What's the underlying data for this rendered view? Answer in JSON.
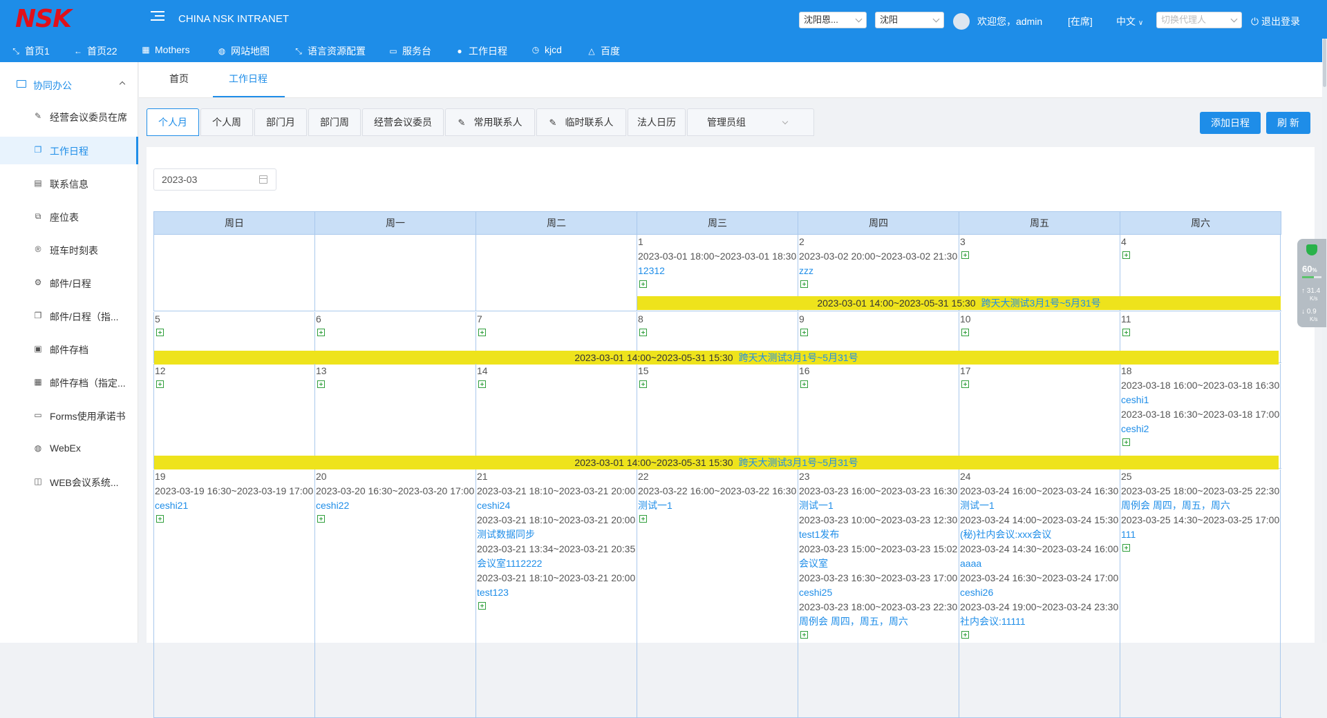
{
  "app": {
    "logo": "NSK",
    "title": "CHINA NSK INTRANET",
    "org_select": "沈阳恩...",
    "city_select": "沈阳",
    "welcome": "欢迎您，admin",
    "status": "[在席]",
    "language": "中文",
    "proxy_placeholder": "切换代理人",
    "logout": "退出登录"
  },
  "nav": [
    {
      "icon": "shrink-icon",
      "label": "首页1"
    },
    {
      "icon": "back-arrow-icon",
      "label": "首页22"
    },
    {
      "icon": "grid-icon",
      "label": "Mothers"
    },
    {
      "icon": "globe-icon",
      "label": "网站地图"
    },
    {
      "icon": "shrink-icon",
      "label": "语言资源配置"
    },
    {
      "icon": "monitor-icon",
      "label": "服务台"
    },
    {
      "icon": "calendar-badge-icon",
      "label": "工作日程"
    },
    {
      "icon": "clock-icon",
      "label": "kjcd"
    },
    {
      "icon": "warning-icon",
      "label": "百度"
    }
  ],
  "sidebar": {
    "group": "协同办公",
    "items": [
      {
        "icon": "edit-icon",
        "label": "经营会议委员在席"
      },
      {
        "icon": "copy-icon",
        "label": "工作日程"
      },
      {
        "icon": "contact-file-icon",
        "label": "联系信息"
      },
      {
        "icon": "seat-icon",
        "label": "座位表"
      },
      {
        "icon": "registered-icon",
        "label": "班车时刻表"
      },
      {
        "icon": "gear-icon",
        "label": "邮件/日程"
      },
      {
        "icon": "copy-icon",
        "label": "邮件/日程（指..."
      },
      {
        "icon": "image-icon",
        "label": "邮件存档"
      },
      {
        "icon": "grid-icon",
        "label": "邮件存档（指定..."
      },
      {
        "icon": "form-icon",
        "label": "Forms使用承诺书"
      },
      {
        "icon": "globe-icon",
        "label": "WebEx"
      },
      {
        "icon": "window-icon",
        "label": "WEB会议系统..."
      }
    ]
  },
  "tabs": [
    "首页",
    "工作日程"
  ],
  "subtabs": [
    "个人月",
    "个人周",
    "部门月",
    "部门周",
    "经营会议委员",
    "常用联系人",
    "临时联系人",
    "法人日历",
    "管理员组"
  ],
  "buttons": {
    "add": "添加日程",
    "refresh": "刷 新"
  },
  "month_value": "2023-03",
  "weekdays": [
    "周日",
    "周一",
    "周二",
    "周三",
    "周四",
    "周五",
    "周六"
  ],
  "span_event": {
    "time": "2023-03-01 14:00~2023-05-31 15:30",
    "title": "跨天大测试3月1号~5月31号"
  },
  "weeks": [
    {
      "days": [
        {
          "d": "",
          "events": []
        },
        {
          "d": "",
          "events": []
        },
        {
          "d": "",
          "events": []
        },
        {
          "d": "1",
          "add": true,
          "events": [
            {
              "time": "2023-03-01 18:00~2023-03-01 18:30",
              "title": "12312"
            }
          ]
        },
        {
          "d": "2",
          "add": true,
          "events": [
            {
              "time": "2023-03-02 20:00~2023-03-02 21:30",
              "title": "zzz"
            }
          ]
        },
        {
          "d": "3",
          "add": true,
          "events": []
        },
        {
          "d": "4",
          "add": true,
          "events": []
        }
      ]
    },
    {
      "days": [
        {
          "d": "5",
          "add": true,
          "events": []
        },
        {
          "d": "6",
          "add": true,
          "events": []
        },
        {
          "d": "7",
          "add": true,
          "events": []
        },
        {
          "d": "8",
          "add": true,
          "events": []
        },
        {
          "d": "9",
          "add": true,
          "events": []
        },
        {
          "d": "10",
          "add": true,
          "events": []
        },
        {
          "d": "11",
          "add": true,
          "events": []
        }
      ]
    },
    {
      "days": [
        {
          "d": "12",
          "add": true,
          "events": []
        },
        {
          "d": "13",
          "add": true,
          "events": []
        },
        {
          "d": "14",
          "add": true,
          "events": []
        },
        {
          "d": "15",
          "add": true,
          "events": []
        },
        {
          "d": "16",
          "add": true,
          "events": []
        },
        {
          "d": "17",
          "add": true,
          "events": []
        },
        {
          "d": "18",
          "add": true,
          "events": [
            {
              "time": "2023-03-18 16:00~2023-03-18 16:30",
              "title": "ceshi1"
            },
            {
              "time": "2023-03-18 16:30~2023-03-18 17:00",
              "title": "ceshi2"
            }
          ]
        }
      ]
    },
    {
      "days": [
        {
          "d": "19",
          "add": true,
          "events": [
            {
              "time": "2023-03-19 16:30~2023-03-19 17:00",
              "title": "ceshi21"
            }
          ]
        },
        {
          "d": "20",
          "add": true,
          "events": [
            {
              "time": "2023-03-20 16:30~2023-03-20 17:00",
              "title": "ceshi22"
            }
          ]
        },
        {
          "d": "21",
          "add": true,
          "events": [
            {
              "time": "2023-03-21 18:10~2023-03-21 20:00",
              "title": "ceshi24"
            },
            {
              "time": "2023-03-21 18:10~2023-03-21 20:00",
              "title": "测试数据同步"
            },
            {
              "time": "2023-03-21 13:34~2023-03-21 20:35",
              "title": "会议室1112222"
            },
            {
              "time": "2023-03-21 18:10~2023-03-21 20:00",
              "title": "test123"
            }
          ]
        },
        {
          "d": "22",
          "add": true,
          "events": [
            {
              "time": "2023-03-22 16:00~2023-03-22 16:30",
              "title": "测试一1"
            }
          ]
        },
        {
          "d": "23",
          "add": true,
          "events": [
            {
              "time": "2023-03-23 16:00~2023-03-23 16:30",
              "title": "测试一1"
            },
            {
              "time": "2023-03-23 10:00~2023-03-23 12:30",
              "title": "test1发布"
            },
            {
              "time": "2023-03-23 15:00~2023-03-23 15:02",
              "title": "会议室"
            },
            {
              "time": "2023-03-23 16:30~2023-03-23 17:00",
              "title": "ceshi25"
            },
            {
              "time": "2023-03-23 18:00~2023-03-23 22:30",
              "title": "周例会 周四，周五，周六"
            }
          ]
        },
        {
          "d": "24",
          "add": true,
          "events": [
            {
              "time": "2023-03-24 16:00~2023-03-24 16:30",
              "title": "测试一1"
            },
            {
              "time": "2023-03-24 14:00~2023-03-24 15:30",
              "title": "(秘)社内会议:xxx会议"
            },
            {
              "time": "2023-03-24 14:30~2023-03-24 16:00",
              "title": "aaaa"
            },
            {
              "time": "2023-03-24 16:30~2023-03-24 17:00",
              "title": "ceshi26"
            },
            {
              "time": "2023-03-24 19:00~2023-03-24 23:30",
              "title": "社内会议:11111"
            }
          ]
        },
        {
          "d": "25",
          "add": true,
          "events": [
            {
              "time": "2023-03-25 18:00~2023-03-25 22:30",
              "title": "周例会 周四，周五，周六"
            },
            {
              "time": "2023-03-25 14:30~2023-03-25 17:00",
              "title": "111"
            }
          ]
        }
      ]
    }
  ],
  "net_monitor": {
    "percent": "60",
    "percent_unit": "%",
    "up": "31.4",
    "down": "0.9",
    "unit": "K/s"
  },
  "colors": {
    "brand_blue": "#1e8de8",
    "logo_red": "#e0101a",
    "span_bar": "#eee31c",
    "grid_line": "#a9c8ec",
    "header_fill": "#c9dff7"
  }
}
